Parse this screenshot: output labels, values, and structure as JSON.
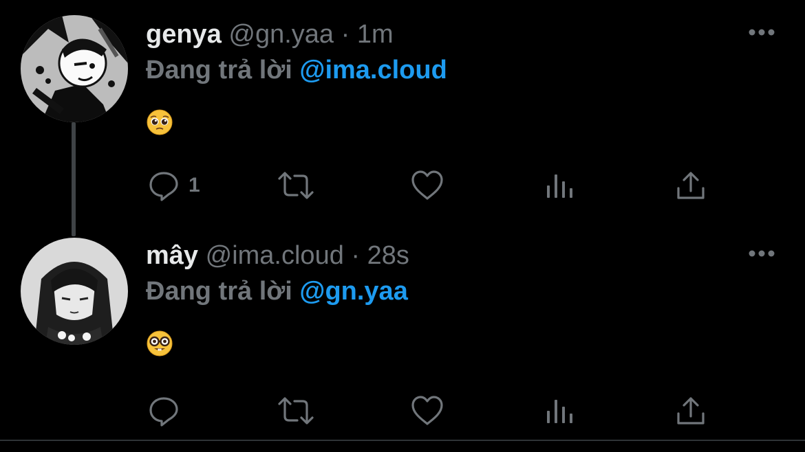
{
  "colors": {
    "background": "#000000",
    "text_primary": "#e7e9ea",
    "text_secondary": "#71767b",
    "accent": "#1d9bf0",
    "thread_line": "#3f4346"
  },
  "tweets": [
    {
      "display_name": "genya",
      "handle": "@gn.yaa",
      "separator": "·",
      "time": "1m",
      "reply_prefix": "Đang trả lời",
      "reply_to": "@ima.cloud",
      "body_emoji": "pleading-face",
      "reply_count": "1",
      "icons": {
        "reply": "reply-bubble-icon",
        "retweet": "retweet-icon",
        "like": "heart-icon",
        "views": "views-chart-icon",
        "share": "share-icon",
        "more": "more-dots-icon"
      }
    },
    {
      "display_name": "mây",
      "handle": "@ima.cloud",
      "separator": "·",
      "time": "28s",
      "reply_prefix": "Đang trả lời",
      "reply_to": "@gn.yaa",
      "body_emoji": "nerd-face",
      "reply_count": "",
      "icons": {
        "reply": "reply-bubble-icon",
        "retweet": "retweet-icon",
        "like": "heart-icon",
        "views": "views-chart-icon",
        "share": "share-icon",
        "more": "more-dots-icon"
      }
    }
  ]
}
